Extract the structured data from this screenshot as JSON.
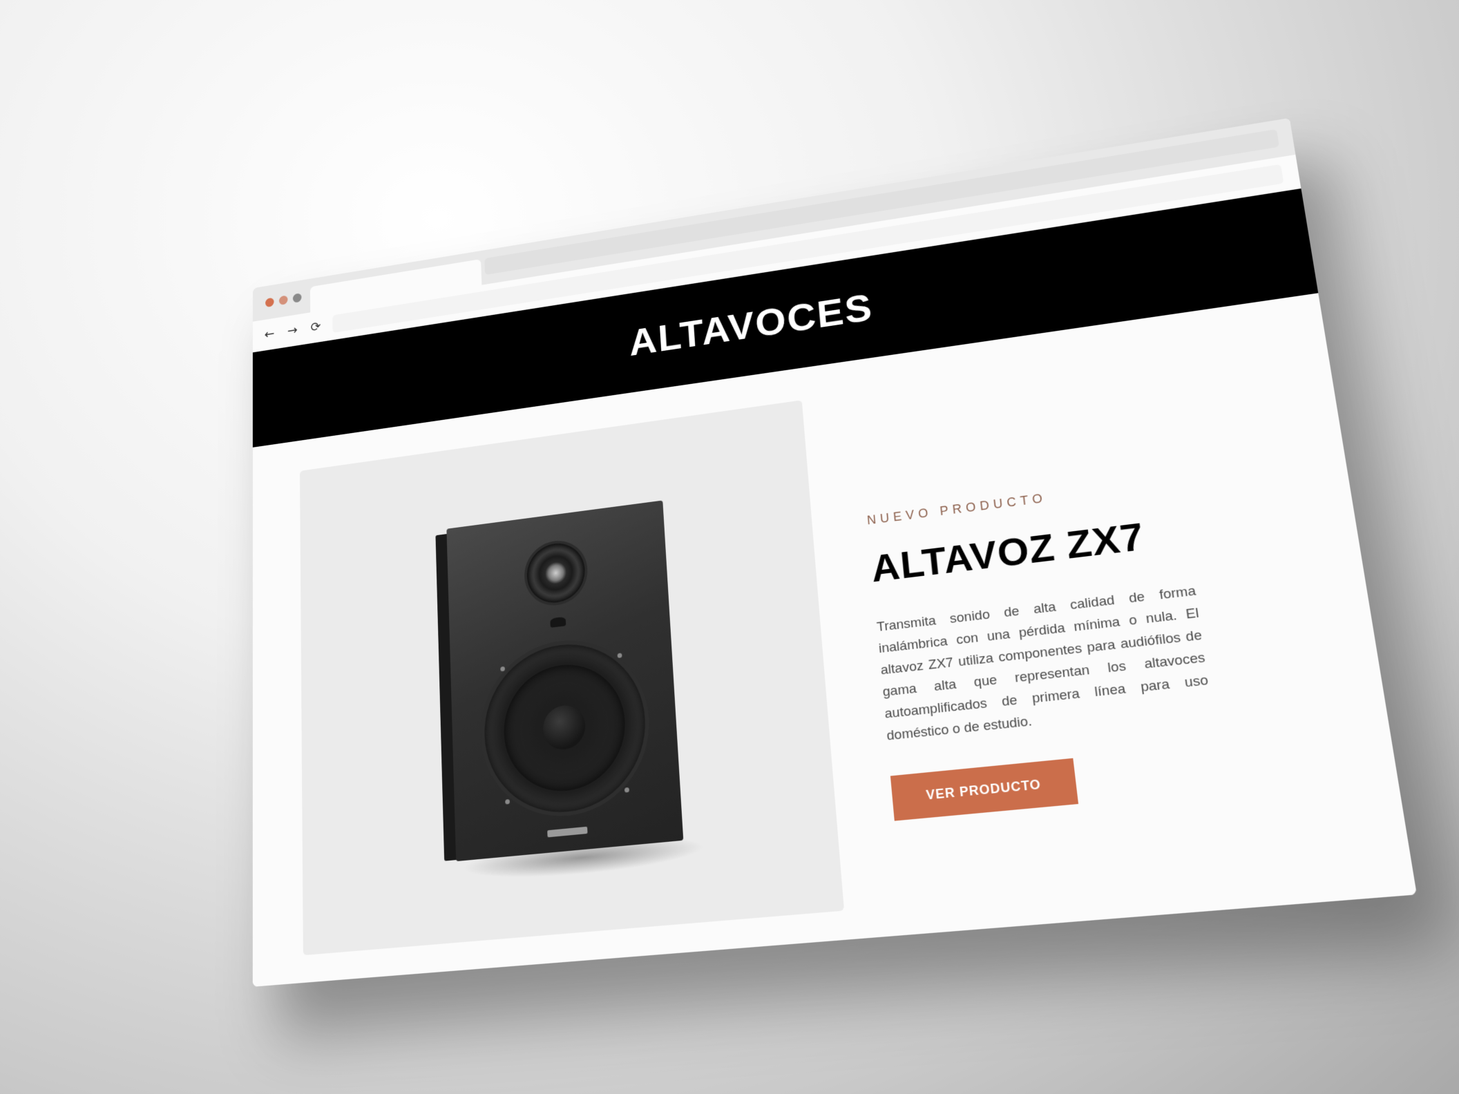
{
  "browser": {
    "dots": [
      {
        "name": "close",
        "color": "#d4714f"
      },
      {
        "name": "minimize",
        "color": "#d4917a"
      },
      {
        "name": "maximize",
        "color": "#8a8a8a"
      }
    ],
    "nav_icons": {
      "back": "←",
      "forward": "→",
      "reload": "⟳"
    },
    "address": ""
  },
  "header": {
    "title": "ALTAVOCES"
  },
  "product": {
    "eyebrow": "NUEVO PRODUCTO",
    "title": "ALTAVOZ ZX7",
    "description": "Transmita sonido de alta calidad de forma inalámbrica con una pérdida mínima o nula. El altavoz ZX7 utiliza componentes para audiófilos de gama alta que representan los altavoces autoamplificados de primera línea para uso doméstico o de estudio.",
    "cta_label": "VER PRODUCTO",
    "accent_color": "#cb6e4b"
  }
}
